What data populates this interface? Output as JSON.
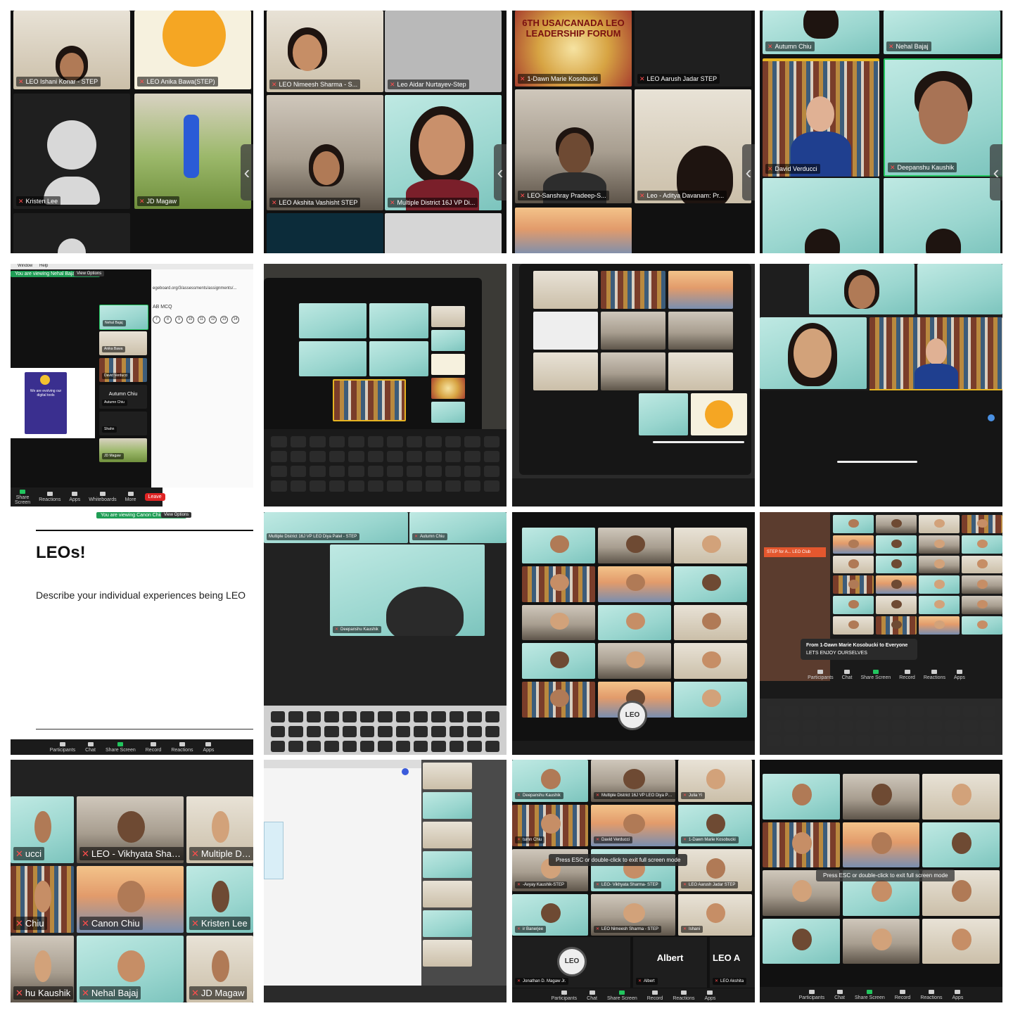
{
  "tiles": {
    "t1": {
      "labels": [
        "LEO Ishani Konar - STEP",
        "LEO Anika Bawa(STEP)",
        "Kristen Lee",
        "JD Magaw"
      ]
    },
    "t2": {
      "labels": [
        "LEO Nimeesh Sharma - S...",
        "Leo Aidar Nurtayev-Step",
        "LEO Akshita Vashisht STEP",
        "Multiple District 16J VP Di..."
      ]
    },
    "t3": {
      "labels": [
        "1-Dawn Marie Kosobucki",
        "LEO Aarush Jadar STEP",
        "LEO-Sanshray Pradeep-S...",
        "Leo - Aditya Davanam: Pr..."
      ],
      "poster_text": "6TH USA/CANADA LEO LEADERSHIP FORUM"
    },
    "t4": {
      "labels": [
        "Autumn Chiu",
        "Nehal Bajaj",
        "David Verducci",
        "Deepanshu Kaushik"
      ]
    },
    "t5": {
      "menu": [
        "Window",
        "Help"
      ],
      "share_banner": "You are viewing Nehal Bajaj's screen",
      "view_options": "View Options",
      "url": "egeboard.org/3/assessments/assignments/...",
      "mcq": "AB MCQ",
      "mcq_numbers": [
        "7",
        "8",
        "9",
        "10",
        "11",
        "12",
        "13",
        "14"
      ],
      "promo_text": "We are evolving our digital tools",
      "side_labels": [
        "Nehal Bajaj",
        "Anika Bawa",
        "David Verducci",
        "Autumn Chiu",
        "Autumn Chiu",
        "Shahn",
        "JD Magaw"
      ],
      "toolbar": [
        "Share Screen",
        "Reactions",
        "Apps",
        "Whiteboards",
        "More"
      ],
      "leave": "Leave"
    },
    "t9": {
      "banner": "You are viewing Canon Chiu's screen",
      "view_options": "View Options",
      "title": "LEOs!",
      "body": "Describe your individual experiences being LEO",
      "toolbar": [
        "Participants",
        "Chat",
        "Share Screen",
        "Record",
        "Reactions",
        "Apps"
      ]
    },
    "t10": {
      "labels": [
        "Multiple District 16J VP LEO Diya Patel - STEP",
        "Autumn Chiu",
        "Deepanshu Kaushik"
      ]
    },
    "t12": {
      "chat_from": "From 1-Dawn Marie Kosobucki to Everyone",
      "chat_msg": "LETS ENJOY OURSELVES",
      "side_text": "STEP for A... LEO Club",
      "toolbar": [
        "Participants",
        "Chat",
        "Share Screen",
        "Record",
        "Reactions",
        "Apps"
      ]
    },
    "t13": {
      "labels": [
        "ucci",
        "LEO - Vikhyata Sharma...",
        "Multiple Distri",
        "Chiu",
        "Canon Chiu",
        "Kristen Lee",
        "hu Kaushik",
        "Nehal Bajaj",
        "JD Magaw"
      ]
    },
    "t15": {
      "labels": [
        "Deepanshu Kaushik",
        "Multiple District 16J VP LEO Diya Patel - STEP",
        "Julia Yi",
        "tumn Chiu",
        "David Verducci",
        "1-Dawn Marie Kosobucki",
        "-Avyay Kaushik-STEP",
        "LEO- Vikhyata Sharma- STEP",
        "LEO Aarush Jadar STEP",
        "ir Banerjee",
        "LEO Nimeesh Sharma - STEP",
        "Ishani",
        "Jonathan D. Magaw Jr.",
        "Albert",
        "LEO Akshita"
      ],
      "toast": "Press ESC or double-click to exit full screen mode",
      "albert": "Albert",
      "leo_name": "LEO A",
      "toolbar": [
        "Participants",
        "Chat",
        "Share Screen",
        "Record",
        "Reactions",
        "Apps"
      ]
    },
    "t16": {
      "toast": "Press ESC or double-click to exit full screen mode",
      "toolbar": [
        "Participants",
        "Chat",
        "Share Screen",
        "Record",
        "Reactions",
        "Apps"
      ]
    }
  },
  "colors": {
    "zoom_green": "#22c55e",
    "mic_red": "#ff4d4d",
    "leave_red": "#e02424",
    "zoom_dark": "#1b1b1b"
  }
}
